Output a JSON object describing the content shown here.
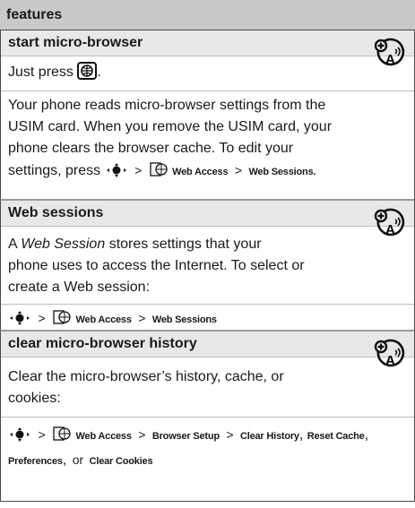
{
  "header": {
    "title": "features"
  },
  "sections": [
    {
      "title": "start micro-browser",
      "line1_pre": "Just press",
      "line1_post": ".",
      "body": [
        "Your phone reads micro-browser settings from the",
        "USIM card. When you remove the USIM card, your",
        "phone clears the browser cache. To edit your"
      ],
      "path_prefix": "settings, press",
      "path_web_access": "Web Access",
      "path_sep": ">",
      "path_target": "Web Sessions",
      "path_end": "."
    },
    {
      "title": "Web sessions",
      "intro_pre": "A",
      "intro_em": "Web Session",
      "intro_post": "stores settings that your",
      "body": [
        "phone uses to access the Internet. To select or",
        "create a Web session:"
      ],
      "path_web_access": "Web Access",
      "path_sep": ">",
      "path_target": "Web Sessions"
    },
    {
      "title": "clear micro-browser history",
      "body": [
        "Clear the micro-browser’s history, cache, or",
        "cookies:"
      ],
      "path_web_access": "Web Access",
      "path_sep": ">",
      "path_browser_setup": "Browser Setup",
      "path_clear_history": "Clear History",
      "comma": ",",
      "path_reset_cache": "Reset Cache",
      "path_preferences": "Preferences",
      "or_word": "or",
      "path_clear_cookies": "Clear Cookies"
    }
  ],
  "icons": {
    "feature": "network-feature-icon",
    "web_key": "web-browser-key-icon",
    "nav": "navigation-key-icon",
    "web_access": "web-access-icon"
  },
  "colors": {
    "header_bg": "#c9c9c9",
    "title_bg": "#e8e8e8"
  }
}
